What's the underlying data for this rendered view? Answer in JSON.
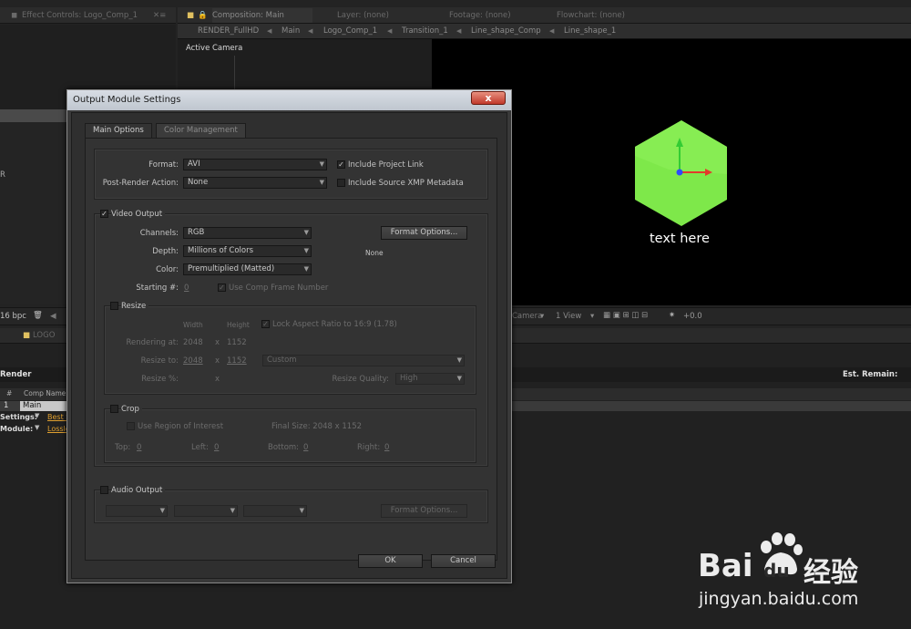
{
  "effect_panel": {
    "tab": "Effect Controls: Logo_Comp_1"
  },
  "comp_panel": {
    "tabs": [
      "Composition: Main",
      "Layer: (none)",
      "Footage: (none)",
      "Flowchart: (none)"
    ],
    "breadcrumbs": [
      "RENDER_FullHD",
      "Main",
      "Logo_Comp_1",
      "Transition_1",
      "Line_shape_Comp",
      "Line_shape_1"
    ],
    "active_camera": "Active Camera",
    "viewer_text": "text here",
    "footer": {
      "bpc": "16 bpc",
      "camera": "Camera",
      "views": "1 View",
      "offset": "+0.0"
    }
  },
  "left_panel": {
    "item": "R"
  },
  "render_queue": {
    "tab": "LOGO",
    "title": "Render",
    "est_remain": "Est. Remain:",
    "col_num": "#",
    "col_comp": "Comp Name",
    "row_num": "1",
    "row_comp": "Main",
    "settings_label": "Settings:",
    "settings_value": "Best S",
    "module_label": "Module:",
    "module_value": "Lossle"
  },
  "dialog": {
    "title": "Output Module Settings",
    "close": "x",
    "tabs": [
      "Main Options",
      "Color Management"
    ],
    "format_label": "Format:",
    "format_value": "AVI",
    "post_render_label": "Post-Render Action:",
    "post_render_value": "None",
    "include_project_link": "Include Project Link",
    "include_xmp": "Include Source XMP Metadata",
    "video_output": "Video Output",
    "channels_label": "Channels:",
    "channels_value": "RGB",
    "format_options": "Format Options...",
    "depth_label": "Depth:",
    "depth_value": "Millions of Colors",
    "codec_none": "None",
    "color_label": "Color:",
    "color_value": "Premultiplied (Matted)",
    "starting_label": "Starting #:",
    "starting_value": "0",
    "use_comp_frame": "Use Comp Frame Number",
    "resize": "Resize",
    "width_hdr": "Width",
    "height_hdr": "Height",
    "lock_aspect": "Lock Aspect Ratio to 16:9 (1.78)",
    "rendering_at": "Rendering at:",
    "rendering_w": "2048",
    "rendering_h": "1152",
    "resize_to": "Resize to:",
    "resize_w": "2048",
    "resize_h": "1152",
    "resize_preset": "Custom",
    "resize_pct": "Resize %:",
    "x_sep": "x",
    "resize_quality": "Resize Quality:",
    "resize_quality_value": "High",
    "crop": "Crop",
    "use_roi": "Use Region of Interest",
    "final_size": "Final Size: 2048 x 1152",
    "top_label": "Top:",
    "top_value": "0",
    "left_label": "Left:",
    "left_value": "0",
    "bottom_label": "Bottom:",
    "bottom_value": "0",
    "right_label": "Right:",
    "right_value": "0",
    "audio_output": "Audio Output",
    "audio_format_options": "Format Options...",
    "ok": "OK",
    "cancel": "Cancel"
  },
  "watermark": {
    "brand_a": "Bai",
    "brand_b": "du",
    "brand_cn": "经验",
    "url": "jingyan.baidu.com"
  },
  "colors": {
    "hex_green": "#7ee84a",
    "axis_red": "#e23b2b",
    "axis_green": "#33cc33",
    "axis_blue": "#2d4bff"
  }
}
